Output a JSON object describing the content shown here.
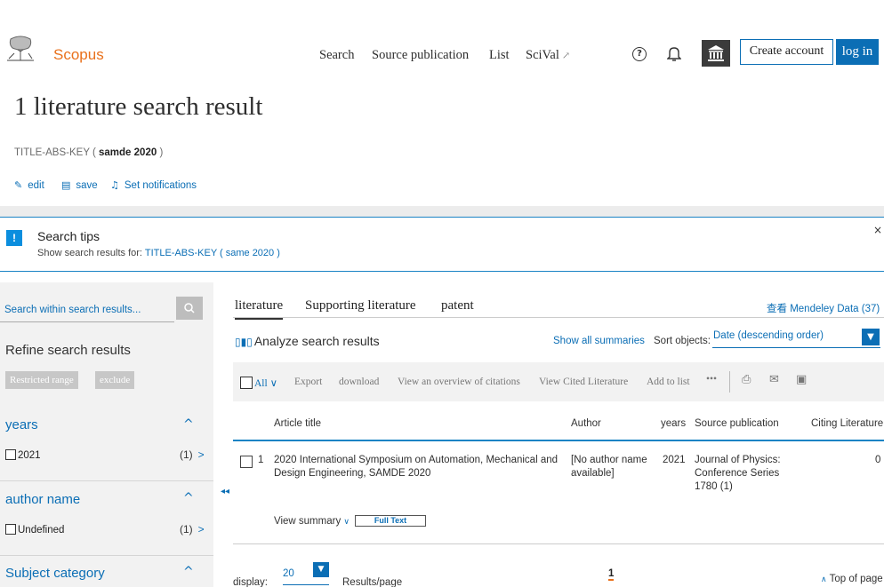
{
  "header": {
    "brand": "Scopus",
    "nav": {
      "search": "Search",
      "source": "Source publication",
      "list": "List",
      "scival": "SciVal",
      "scival_ext": "↗"
    },
    "help_glyph": "?",
    "create_account": "Create account",
    "login": "log in"
  },
  "page": {
    "title": "1 literature search result",
    "query_prefix": "TITLE-ABS-KEY  (",
    "query_terms": "samde  2020",
    "query_suffix": ")",
    "actions": {
      "edit": "edit",
      "save": "save",
      "notify": "Set notifications"
    }
  },
  "tips": {
    "badge": "!",
    "title": "Search tips",
    "subtitle": "Show search results for:",
    "suggested_query": "TITLE-ABS-KEY  ( same  2020 )",
    "close": "×"
  },
  "sidebar": {
    "search_placeholder": "Search within search results...",
    "refine_title": "Refine search results",
    "limit": "Restricted range",
    "exclude": "exclude",
    "facets": [
      {
        "title": "years",
        "options": [
          {
            "label": "2021",
            "count": "(1)"
          }
        ]
      },
      {
        "title": "author name",
        "options": [
          {
            "label": "Undefined",
            "count": "(1)"
          }
        ]
      },
      {
        "title": "Subject category",
        "options": []
      }
    ],
    "caret": "^",
    "count_chevron": ">",
    "collapse": "◂◂"
  },
  "main": {
    "tabs": {
      "literature": "literature",
      "supporting": "Supporting literature",
      "patent": "patent"
    },
    "mendeley": "查看 Mendeley Data (37)",
    "analyze": "Analyze search results",
    "show_summaries": "Show all summaries",
    "sort_label": "Sort objects:",
    "sort_value": "Date (descending order)",
    "toolbar": {
      "all": "All ∨",
      "export": "Export",
      "download": "download",
      "overview": "View an overview of citations",
      "cited": "View Cited Literature",
      "add_list": "Add to list",
      "more": "•••"
    },
    "columns": {
      "title": "Article title",
      "author": "Author",
      "years": "years",
      "source": "Source publication",
      "citing": "Citing Literature"
    },
    "rows": [
      {
        "num": "1",
        "title": "2020 International Symposium on Automation, Mechanical and Design Engineering, SAMDE 2020",
        "author": "[No author name available]",
        "year": "2021",
        "source": "Journal of Physics: Conference Series 1780 (1)",
        "cites": "0"
      }
    ],
    "view_summary": "View summary",
    "full_text": "Full Text",
    "pagination": {
      "display_label": "display:",
      "per_page": "20",
      "per_page_label": "Results/page",
      "current_page": "1",
      "top_of_page": "Top of page"
    }
  },
  "colors": {
    "brand": "#e9711c",
    "link": "#0b6eb5",
    "accent_line": "#1a83c4"
  }
}
